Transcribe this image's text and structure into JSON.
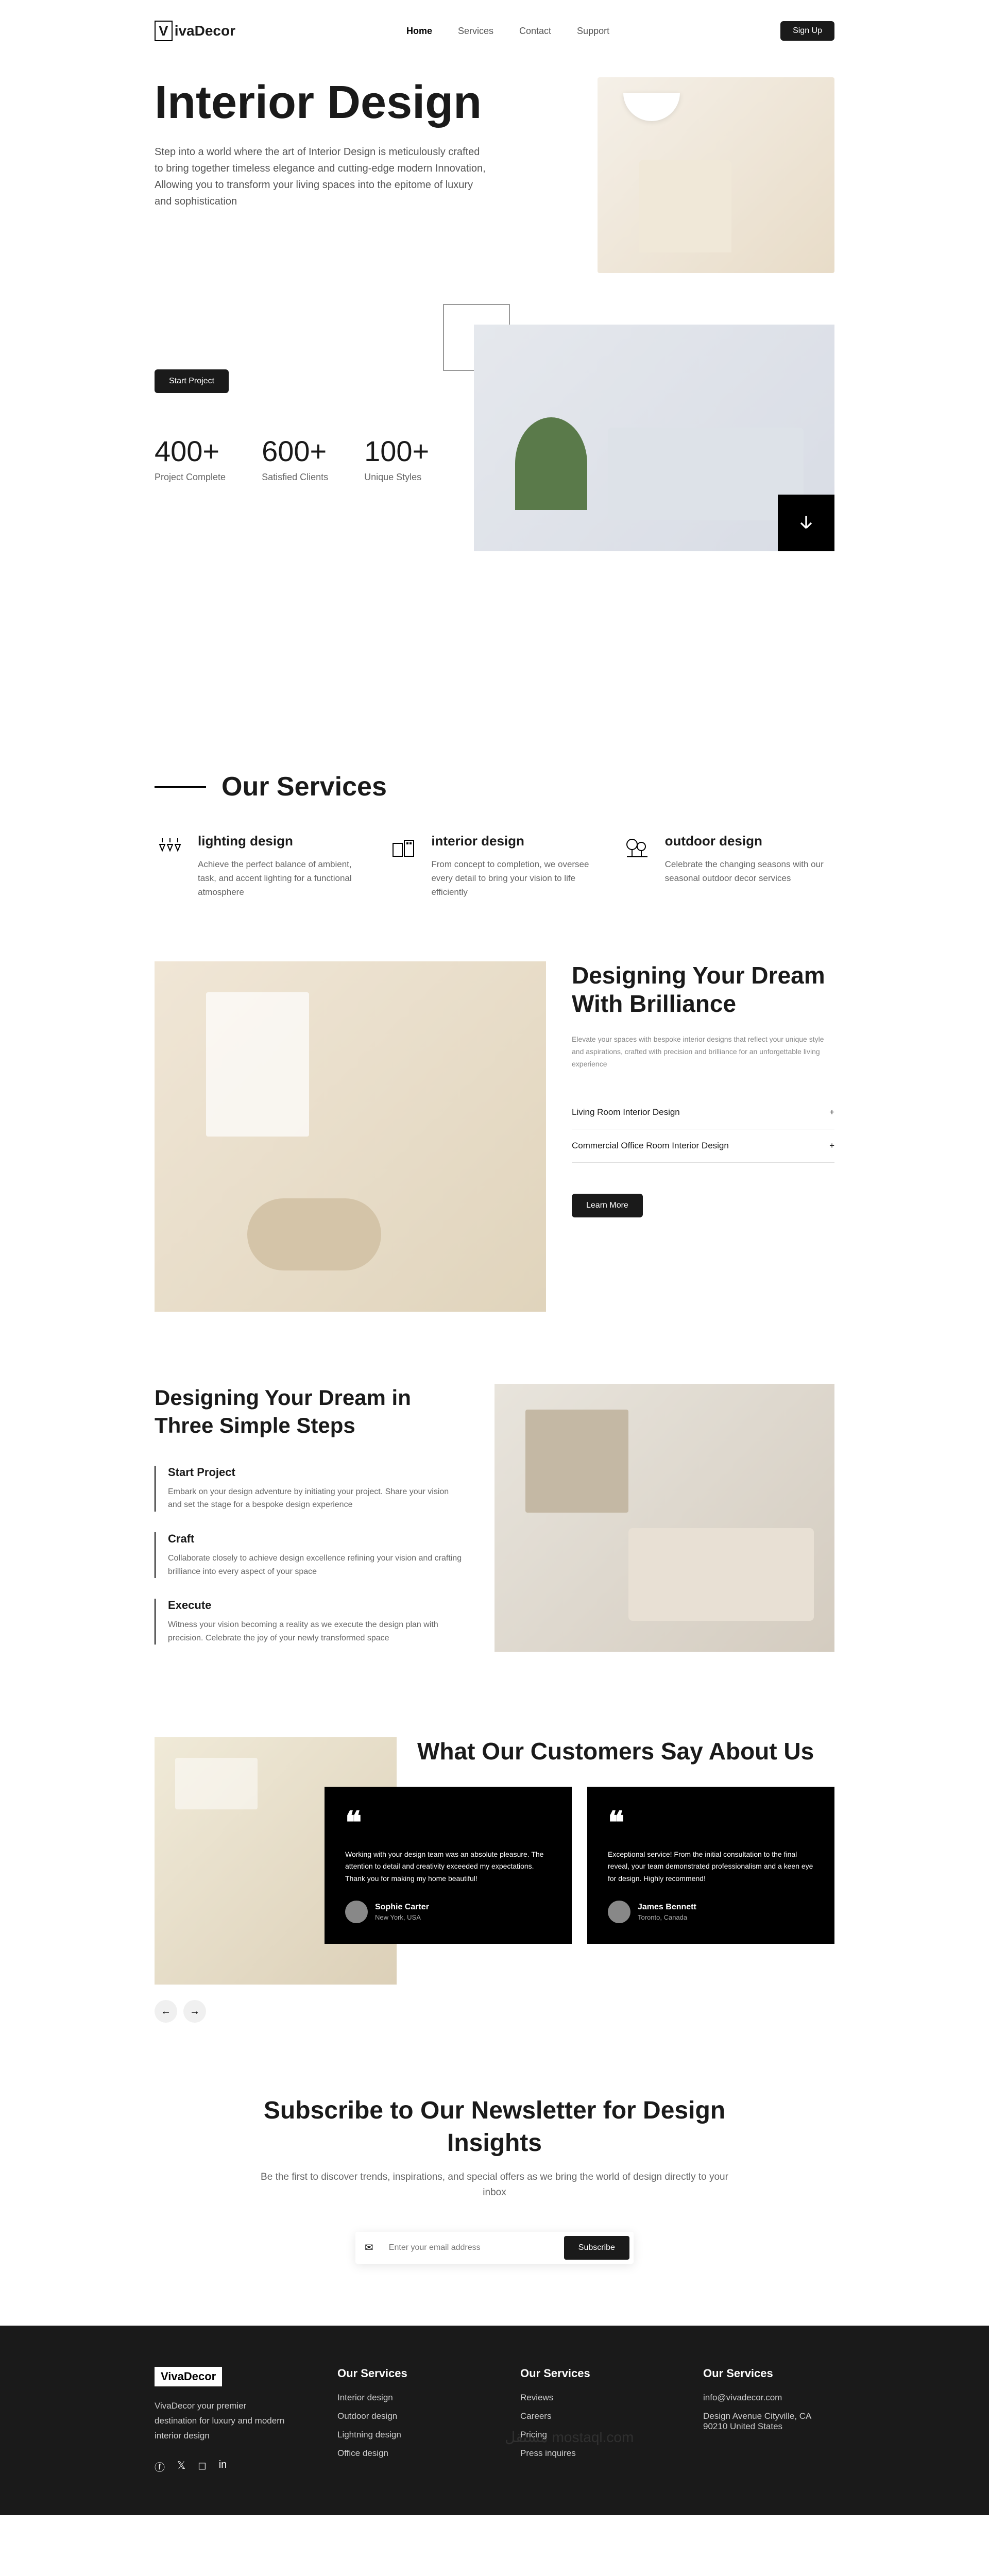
{
  "header": {
    "logo_box": "V",
    "logo_text": "ivaDecor",
    "nav": {
      "home": "Home",
      "services": "Services",
      "contact": "Contact",
      "support": "Support"
    },
    "signup": "Sign Up"
  },
  "hero": {
    "title": "Interior Design",
    "desc": "Step into a world where the art of Interior Design is meticulously crafted to bring together timeless elegance and cutting-edge modern Innovation, Allowing you to transform your living spaces into the epitome of luxury and sophistication",
    "start": "Start Project"
  },
  "stats": [
    {
      "num": "400+",
      "label": "Project Complete"
    },
    {
      "num": "600+",
      "label": "Satisfied Clients"
    },
    {
      "num": "100+",
      "label": "Unique Styles"
    }
  ],
  "services_title": "Our Services",
  "services": [
    {
      "title": "lighting design",
      "desc": "Achieve the perfect balance of ambient, task, and accent lighting for a functional atmosphere"
    },
    {
      "title": "interior design",
      "desc": "From concept to completion, we oversee every detail to bring your vision to life efficiently"
    },
    {
      "title": "outdoor design",
      "desc": "Celebrate the changing seasons with our seasonal outdoor decor services"
    }
  ],
  "dream": {
    "title": "Designing Your Dream With Brilliance",
    "desc": "Elevate your spaces with bespoke interior designs that reflect your unique style and aspirations, crafted with precision and brilliance for an unforgettable living experience",
    "item1": "Living Room Interior Design",
    "item2": "Commercial Office Room Interior Design",
    "learn": "Learn More",
    "plus": "+"
  },
  "steps": {
    "title": "Designing Your Dream in Three Simple Steps",
    "items": [
      {
        "title": "Start Project",
        "desc": "Embark on your design adventure by initiating your project. Share your vision and set the stage for a bespoke design experience"
      },
      {
        "title": "Craft",
        "desc": "Collaborate closely to achieve design excellence refining your vision and crafting brilliance into every aspect of your space"
      },
      {
        "title": "Execute",
        "desc": "Witness your vision becoming a reality as we execute the design plan with precision. Celebrate the joy of your newly transformed space"
      }
    ]
  },
  "testimonials": {
    "title": "What Our Customers Say About Us",
    "quote": "❝",
    "cards": [
      {
        "text": "Working with your design team was an absolute pleasure. The attention to detail and creativity exceeded my expectations. Thank you for making my home beautiful!",
        "name": "Sophie Carter",
        "loc": "New York, USA"
      },
      {
        "text": "Exceptional service! From the initial consultation to the final reveal, your team demonstrated professionalism and a keen eye for design. Highly recommend!",
        "name": "James Bennett",
        "loc": "Toronto, Canada"
      }
    ],
    "prev": "←",
    "next": "→"
  },
  "newsletter": {
    "title": "Subscribe to Our Newsletter for Design Insights",
    "desc": "Be the first to discover trends, inspirations, and special offers as we bring the world of design directly to your inbox",
    "placeholder": "Enter your email address",
    "btn": "Subscribe",
    "mail": "✉"
  },
  "footer": {
    "logo": "VivaDecor",
    "desc": "VivaDecor your premier destination for luxury and modern interior design",
    "col1_title": "Our Services",
    "col1": [
      "Interior design",
      "Outdoor design",
      "Lightning design",
      "Office design"
    ],
    "col2_title": "Our Services",
    "col2": [
      "Reviews",
      "Careers",
      "Pricing",
      "Press inquires"
    ],
    "col3_title": "Our Services",
    "col3": [
      "info@vivadecor.com",
      "Design Avenue Cityville, CA 90210 United States"
    ],
    "watermark": "مستقل mostaql.com"
  }
}
